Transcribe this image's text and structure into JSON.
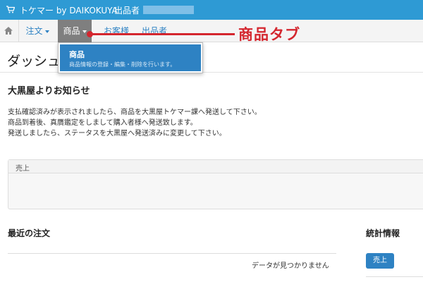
{
  "header": {
    "brand": "トケマー by DAIKOKUYA",
    "seller_label": "出品者"
  },
  "nav": {
    "items": [
      {
        "label": "注文"
      },
      {
        "label": "商品"
      },
      {
        "label": "お客様"
      },
      {
        "label": "出品者"
      }
    ]
  },
  "annotation": {
    "label": "商品タブ",
    "color": "#d4262e"
  },
  "page": {
    "title": "ダッシュボード"
  },
  "dropdown": {
    "title": "商品",
    "description": "商品情報の登録・編集・削除を行います。"
  },
  "notice": {
    "title": "大黒屋よりお知らせ",
    "lines": [
      "支払確認済みが表示されましたら、商品を大黒屋トケマー課へ発送して下さい。",
      "商品到着後、真贋鑑定をしまして購入者様へ発送致します。",
      "発送しましたら、ステータスを大黒屋へ発送済みに変更して下さい。"
    ]
  },
  "sales_panel": {
    "label": "売上"
  },
  "recent_orders": {
    "title": "最近の注文",
    "empty_text": "データが見つかりません"
  },
  "stats": {
    "title": "統計情報",
    "sales_button": "売上"
  },
  "colors": {
    "header_bg": "#2e9ad4",
    "accent": "#2e82c3"
  }
}
